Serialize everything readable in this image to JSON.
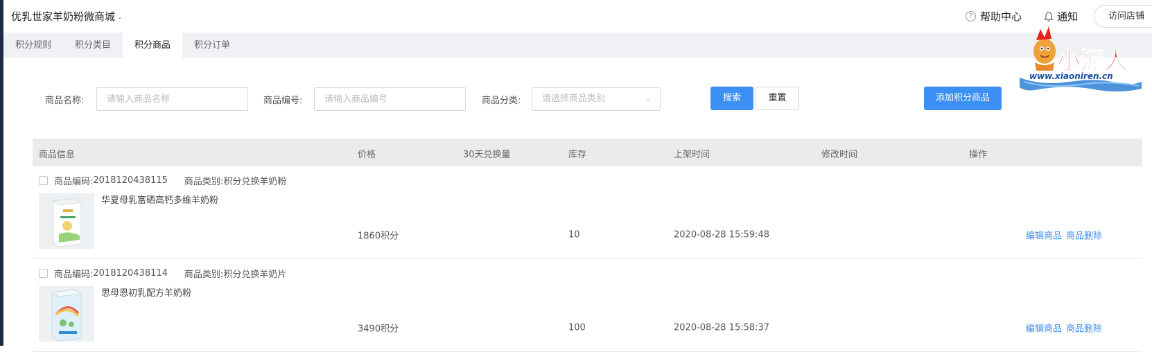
{
  "header": {
    "shop_title": "优乳世家羊奶粉微商城",
    "help_label": "帮助中心",
    "notice_label": "通知",
    "visit_label": "访问店铺"
  },
  "tabs": [
    {
      "label": "积分规则",
      "active": false
    },
    {
      "label": "积分类目",
      "active": false
    },
    {
      "label": "积分商品",
      "active": true
    },
    {
      "label": "积分订单",
      "active": false
    }
  ],
  "filters": {
    "name_label": "商品名称:",
    "name_placeholder": "请输入商品名称",
    "code_label": "商品编号:",
    "code_placeholder": "请输入商品编号",
    "category_label": "商品分类:",
    "category_placeholder": "请选择商品类别",
    "search_label": "搜索",
    "reset_label": "重置",
    "add_label": "添加积分商品"
  },
  "table": {
    "columns": [
      "商品信息",
      "价格",
      "30天兑换量",
      "库存",
      "上架时间",
      "修改时间",
      "操作"
    ],
    "rows": [
      {
        "code_label": "商品编码:",
        "code": "2018120438115",
        "category_label": "商品类别:",
        "category": "积分兑换羊奶粉",
        "name": "华夏母乳富硒高钙多维羊奶粉",
        "price": "1860积分",
        "stock": "10",
        "listed_time": "2020-08-28 15:59:48",
        "edit_label": "编辑商品",
        "delete_label": "商品删除"
      },
      {
        "code_label": "商品编码:",
        "code": "2018120438114",
        "category_label": "商品类别:",
        "category": "积分兑换羊奶片",
        "name": "思母恩初乳配方羊奶粉",
        "price": "3490积分",
        "stock": "100",
        "listed_time": "2020-08-28 15:58:37",
        "edit_label": "编辑商品",
        "delete_label": "商品删除"
      }
    ]
  },
  "watermark": {
    "text": "小泥人",
    "url": "www.xiaoniren.cn"
  },
  "colors": {
    "primary": "#3c8ff4",
    "sidebar": "#1f2a45",
    "tabs_bg": "#f0f1f4",
    "header_row_bg": "#ebebeb",
    "watermark_red": "#e8231b"
  }
}
